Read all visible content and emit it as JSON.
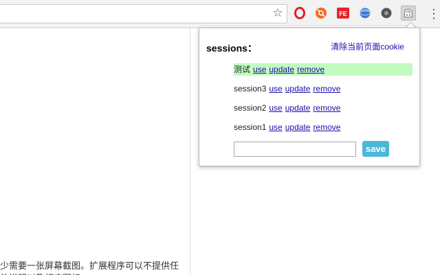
{
  "toolbar": {
    "star_glyph": "☆",
    "menu_glyph": "⋮",
    "extensions": [
      {
        "icon": "opera-o-icon",
        "color": "#e8182a"
      },
      {
        "icon": "orange-sync-icon",
        "color": "#f26b21"
      },
      {
        "icon": "fe-helper-icon",
        "color": "#e8232a",
        "text": "FE"
      },
      {
        "icon": "globe-icon",
        "color": "#3b7bd4"
      },
      {
        "icon": "dark-gear-icon",
        "color": "#555555"
      },
      {
        "icon": "cookie-manager-icon",
        "color": "#777777"
      }
    ]
  },
  "page": {
    "text_line1": "少需要一张屏幕截图。扩展程序可以不提供任",
    "text_line2": "他说明以及相应图标"
  },
  "popup": {
    "title": "sessions：",
    "clear_cookie": "清除当前页面cookie",
    "active_color": "#c2fbbf",
    "sessions": [
      {
        "name": "测试",
        "use": "use",
        "update": "update",
        "remove": "remove",
        "active": true
      },
      {
        "name": "session3",
        "use": "use",
        "update": "update",
        "remove": "remove",
        "active": false
      },
      {
        "name": "session2",
        "use": "use",
        "update": "update",
        "remove": "remove",
        "active": false
      },
      {
        "name": "session1",
        "use": "use",
        "update": "update",
        "remove": "remove",
        "active": false
      }
    ],
    "input_value": "",
    "input_placeholder": "",
    "save_label": "save",
    "save_color": "#4bb8d9"
  }
}
